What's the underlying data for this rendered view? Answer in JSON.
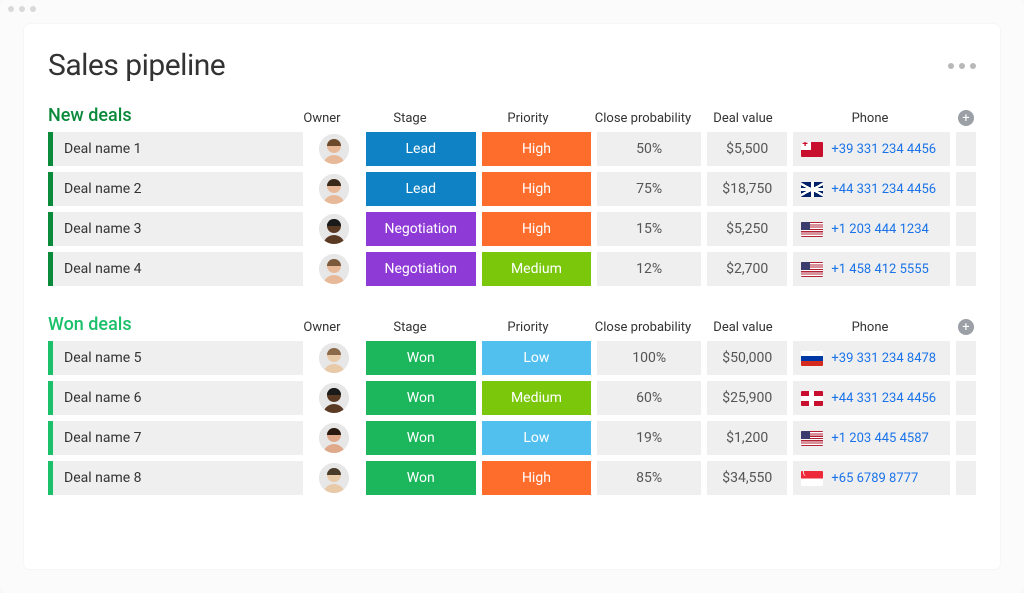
{
  "page_title": "Sales pipeline",
  "columns": {
    "owner": "Owner",
    "stage": "Stage",
    "priority": "Priority",
    "close_probability": "Close probability",
    "deal_value": "Deal value",
    "phone": "Phone"
  },
  "sections": [
    {
      "id": "new",
      "title": "New deals",
      "color": "#0a8a3a",
      "rows": [
        {
          "name": "Deal name 1",
          "owner": "1",
          "stage": "Lead",
          "priority": "High",
          "probability": "50%",
          "value": "$5,500",
          "flag": "it",
          "phone": "+39 331 234 4456"
        },
        {
          "name": "Deal name 2",
          "owner": "2",
          "stage": "Lead",
          "priority": "High",
          "probability": "75%",
          "value": "$18,750",
          "flag": "uk",
          "phone": "+44 331 234 4456"
        },
        {
          "name": "Deal name 3",
          "owner": "3",
          "stage": "Negotiation",
          "priority": "High",
          "probability": "15%",
          "value": "$5,250",
          "flag": "us",
          "phone": "+1 203 444 1234"
        },
        {
          "name": "Deal name 4",
          "owner": "4",
          "stage": "Negotiation",
          "priority": "Medium",
          "probability": "12%",
          "value": "$2,700",
          "flag": "us",
          "phone": "+1 458 412 5555"
        }
      ]
    },
    {
      "id": "won",
      "title": "Won deals",
      "color": "#1cc06a",
      "rows": [
        {
          "name": "Deal name 5",
          "owner": "5",
          "stage": "Won",
          "priority": "Low",
          "probability": "100%",
          "value": "$50,000",
          "flag": "ru",
          "phone": "+39 331 234 8478"
        },
        {
          "name": "Deal name 6",
          "owner": "3",
          "stage": "Won",
          "priority": "Medium",
          "probability": "60%",
          "value": "$25,900",
          "flag": "gg",
          "phone": "+44 331 234 4456"
        },
        {
          "name": "Deal name 7",
          "owner": "6",
          "stage": "Won",
          "priority": "Low",
          "probability": "19%",
          "value": "$1,200",
          "flag": "us",
          "phone": "+1 203 445 4587"
        },
        {
          "name": "Deal name 8",
          "owner": "7",
          "stage": "Won",
          "priority": "High",
          "probability": "85%",
          "value": "$34,550",
          "flag": "sg",
          "phone": "+65 6789 8777"
        }
      ]
    }
  ],
  "avatars": {
    "1": {
      "skin": "#e8b998",
      "hair": "#6b4a2b"
    },
    "2": {
      "skin": "#e8b998",
      "hair": "#3a2a1a"
    },
    "3": {
      "skin": "#5b3a24",
      "hair": "#1a1a1a"
    },
    "4": {
      "skin": "#e8b998",
      "hair": "#7a5a3a"
    },
    "5": {
      "skin": "#e8c9a8",
      "hair": "#8a6a4a"
    },
    "6": {
      "skin": "#e0a98a",
      "hair": "#2a1a10"
    },
    "7": {
      "skin": "#e8c9a8",
      "hair": "#4a3a2a"
    }
  },
  "stage_colors": {
    "Lead": "stage-lead",
    "Negotiation": "stage-negotiation",
    "Won": "stage-won"
  },
  "priority_colors": {
    "High": "prio-high",
    "Medium": "prio-medium",
    "Low": "prio-low"
  }
}
